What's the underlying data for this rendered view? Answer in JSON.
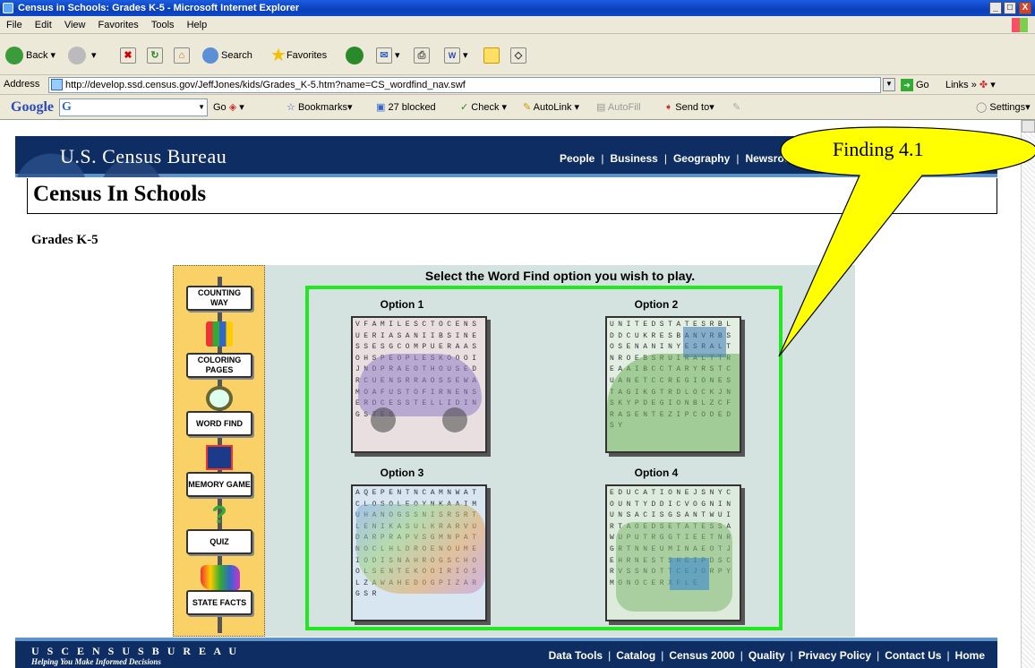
{
  "window": {
    "title": "Census in Schools: Grades K-5 - Microsoft Internet Explorer",
    "controls": {
      "minimize": "_",
      "maximize": "□",
      "close": "X"
    }
  },
  "menu": [
    "File",
    "Edit",
    "View",
    "Favorites",
    "Tools",
    "Help"
  ],
  "toolbar": {
    "back": "Back",
    "search": "Search",
    "favorites": "Favorites"
  },
  "address": {
    "label": "Address",
    "url": "http://develop.ssd.census.gov/JeffJones/kids/Grades_K-5.htm?name=CS_wordfind_nav.swf",
    "go": "Go",
    "links": "Links"
  },
  "google_bar": {
    "logo": "Google",
    "input_prefix": "G",
    "go": "Go",
    "bookmarks": "Bookmarks",
    "blocked": "27 blocked",
    "check": "Check",
    "autolink": "AutoLink",
    "autofill": "AutoFill",
    "send_to": "Send to",
    "settings": "Settings"
  },
  "page": {
    "brand": "U.S. Census Bureau",
    "top_nav": [
      "People",
      "Business",
      "Geography",
      "Newsroom"
    ],
    "section_title": "Census In Schools",
    "subtitle": "Grades K-5",
    "sidebar": [
      {
        "label": "COUNTING WAY"
      },
      {
        "label": "COLORING PAGES"
      },
      {
        "label": "WORD FIND"
      },
      {
        "label": "MEMORY GAME"
      },
      {
        "label": "QUIZ"
      },
      {
        "label": "STATE FACTS"
      }
    ],
    "select_title": "Select the Word Find option you wish to play.",
    "options": [
      {
        "label": "Option 1",
        "grid": "VFAMILESCTOCENSUERIASANIIBSINESSESGCOMPUERAASOHSPEOPLESKOOOIJNDPRAEOTHOUSEDRCUENSRRAOSSEWAMOAFUSTOFIRNENSERDCESSTELLIDINGSTES"
      },
      {
        "label": "Option 2",
        "grid": "UNITEDSTATESRBLDDCUKRESBANVRBSOSENANINYESRALTNROEBSRUIRALTTREAAIBCCTARYRSTCUANETCCREGIONESTAGIKGTRDLOCKJNSKYPDEGIONBLZCFRASENTEZIPCODEDSY"
      },
      {
        "label": "Option 3",
        "grid": "AQEPENTNCAMNWATCLOSOLEOYNKAAIMUHANOGSSNISRSRTLENIKASULKRARVUDARPRAPVSGMNPATNOCLHLDROENOUMEIODISNAHROGSCHOOLSENTEKOOIRIOSLZAWAHEDOGPIZARGSR"
      },
      {
        "label": "Option 4",
        "grid": "EDUCATIONEJSNYCOUNTYDDICVOGNINUNSACISGSANTWUIRTAOEDSETATESSAWUPUTRGGTIEETNRGRTNNEUMINAEOTJEHRNESTSHEIPDSCRVSSNOTTCEJORPYMONOCERXFLE"
      }
    ],
    "footer": {
      "brand": "U S C E N S U S B U R E A U",
      "tagline": "Helping You Make Informed Decisions",
      "nav": [
        "Data Tools",
        "Catalog",
        "Census 2000",
        "Quality",
        "Privacy Policy",
        "Contact Us",
        "Home"
      ]
    }
  },
  "annotation": {
    "callout": "Finding 4.1",
    "fill": "#ffff00"
  }
}
